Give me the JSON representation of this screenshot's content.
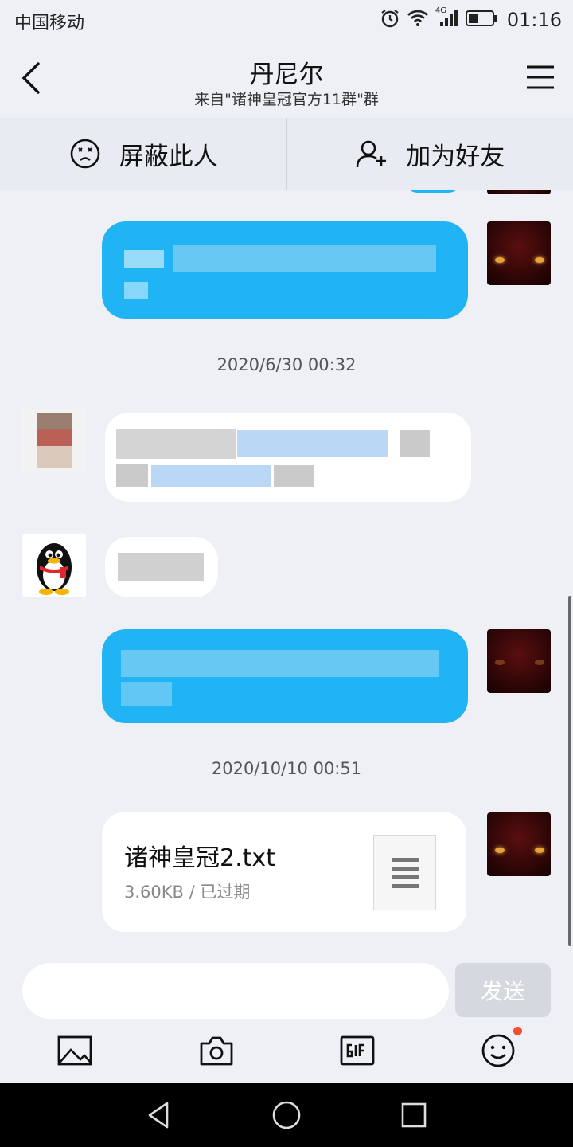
{
  "status_bar": {
    "carrier": "中国移动",
    "network": "4G",
    "time": "01:16"
  },
  "header": {
    "title": "丹尼尔",
    "subtitle": "来自\"诸神皇冠官方11群\"群"
  },
  "actions": {
    "block_label": "屏蔽此人",
    "add_friend_label": "加为好友"
  },
  "chat": {
    "timestamps": [
      "2020/6/30 00:32",
      "2020/10/10 00:51"
    ],
    "file": {
      "name": "诸神皇冠2.txt",
      "meta": "3.60KB / 已过期"
    }
  },
  "input": {
    "value": "",
    "placeholder": "",
    "send_label": "发送"
  },
  "colors": {
    "outgoing_bubble": "#20b4f5",
    "incoming_bubble": "#ffffff",
    "badge": "#f0502d"
  }
}
